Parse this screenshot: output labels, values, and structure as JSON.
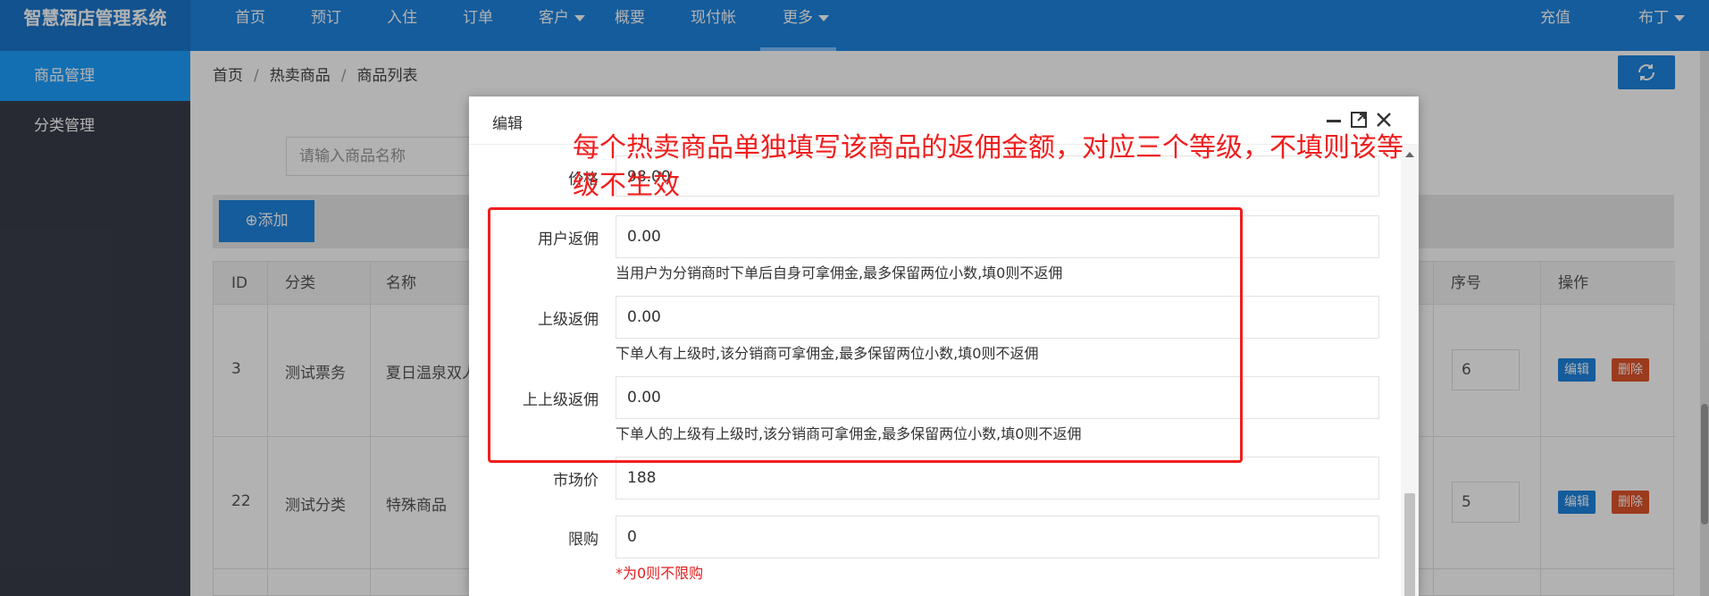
{
  "header": {
    "brand": "智慧酒店管理系统",
    "nav": [
      "首页",
      "预订",
      "入住",
      "订单",
      "客户",
      "概要",
      "现付帐",
      "更多"
    ],
    "right": [
      "充值",
      "布丁"
    ]
  },
  "sidebar": {
    "items": [
      "商品管理",
      "分类管理"
    ]
  },
  "breadcrumb": [
    "首页",
    "热卖商品",
    "商品列表"
  ],
  "search": {
    "placeholder": "请输入商品名称"
  },
  "toolbar": {
    "add_label": "添加"
  },
  "table": {
    "headers": [
      "ID",
      "分类",
      "名称",
      "序号",
      "操作"
    ],
    "rows": [
      {
        "id": "3",
        "category": "测试票务",
        "name": "夏日温泉双人",
        "seq": "6"
      },
      {
        "id": "22",
        "category": "测试分类",
        "name": "特殊商品",
        "seq": "5"
      }
    ],
    "edit_label": "编辑",
    "delete_label": "删除"
  },
  "modal": {
    "title": "编辑",
    "price_label": "价格",
    "price_value": "98.00",
    "fields": [
      {
        "label": "用户返佣",
        "value": "0.00",
        "hint": "当用户为分销商时下单后自身可拿佣金,最多保留两位小数,填0则不返佣"
      },
      {
        "label": "上级返佣",
        "value": "0.00",
        "hint": "下单人有上级时,该分销商可拿佣金,最多保留两位小数,填0则不返佣"
      },
      {
        "label": "上上级返佣",
        "value": "0.00",
        "hint": "下单人的上级有上级时,该分销商可拿佣金,最多保留两位小数,填0则不返佣"
      }
    ],
    "market_label": "市场价",
    "market_value": "188",
    "limit_label": "限购",
    "limit_value": "0",
    "limit_hint": "*为0则不限购"
  },
  "annotation": {
    "text": "每个热卖商品单独填写该商品的返佣金额，对应三个等级，不填则该等级不生效",
    "color": "#f01e1e"
  }
}
